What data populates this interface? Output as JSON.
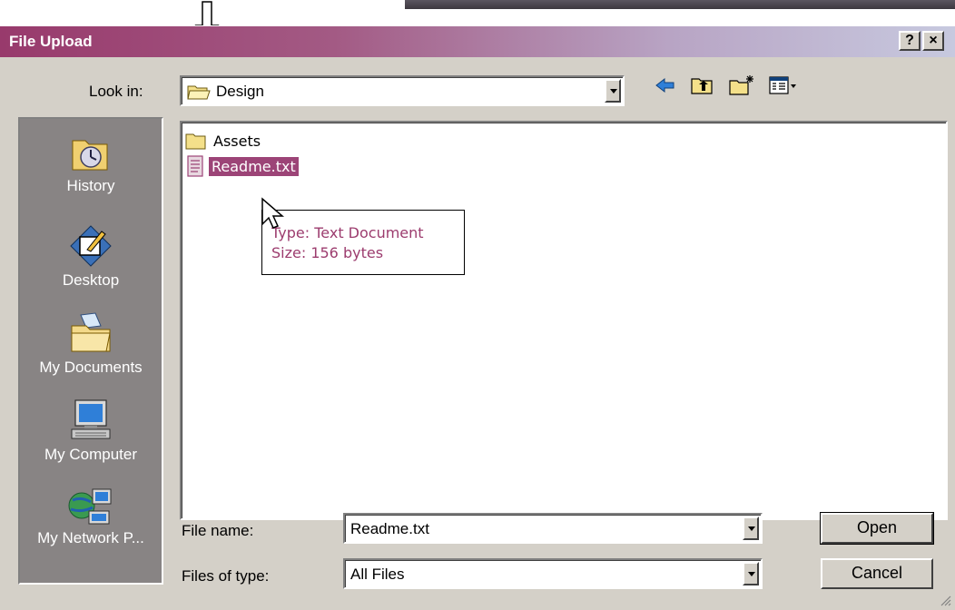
{
  "window": {
    "title": "File Upload",
    "help_label": "?",
    "close_label": "×"
  },
  "look_in": {
    "label": "Look in:",
    "value": "Design"
  },
  "toolbar": {
    "icons": [
      "back-arrow-icon",
      "up-folder-icon",
      "new-folder-icon",
      "view-menu-icon"
    ]
  },
  "places": [
    {
      "label": "History",
      "icon": "history-icon"
    },
    {
      "label": "Desktop",
      "icon": "desktop-icon"
    },
    {
      "label": "My Documents",
      "icon": "my-documents-icon"
    },
    {
      "label": "My Computer",
      "icon": "my-computer-icon"
    },
    {
      "label": "My Network P...",
      "icon": "my-network-places-icon"
    }
  ],
  "files": [
    {
      "name": "Assets",
      "type": "folder",
      "selected": false
    },
    {
      "name": "Readme.txt",
      "type": "text-file",
      "selected": true
    }
  ],
  "tooltip": {
    "type_line": "Type: Text Document",
    "size_line": "Size: 156 bytes"
  },
  "file_name": {
    "label": "File name:",
    "value": "Readme.txt"
  },
  "file_type": {
    "label": "Files of type:",
    "value": "All Files"
  },
  "buttons": {
    "open": "Open",
    "cancel": "Cancel"
  },
  "colors": {
    "title_start": "#983a6c",
    "title_end": "#c7c9df",
    "selection": "#9c4477",
    "tooltip_text": "#9c3c6e",
    "face": "#d4d0c8"
  }
}
